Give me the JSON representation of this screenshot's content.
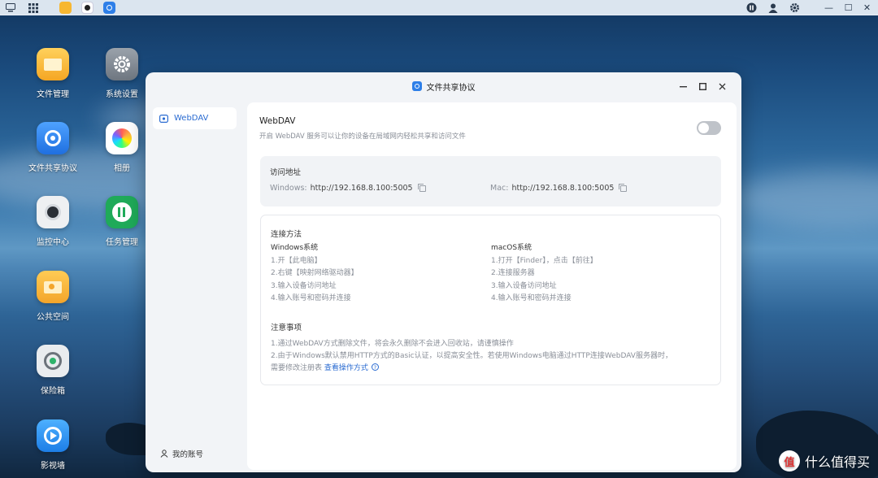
{
  "taskbar": {
    "right_icons": [
      "info-icon",
      "user-icon",
      "gear-icon"
    ],
    "window_controls": {
      "minimize": "—",
      "maximize": "☐",
      "close": "✕"
    }
  },
  "desktop_icons": [
    {
      "label": "文件管理",
      "icon": "folder-icon",
      "color": "#f7b731"
    },
    {
      "label": "系统设置",
      "icon": "gear-icon",
      "color": "#7d858f"
    },
    {
      "label": "文件共享协议",
      "icon": "share-icon",
      "color": "#2e7fe8"
    },
    {
      "label": "相册",
      "icon": "photos-icon",
      "color": "#ffffff"
    },
    {
      "label": "监控中心",
      "icon": "camera-icon",
      "color": "#e9ecef"
    },
    {
      "label": "任务管理",
      "icon": "tasks-icon",
      "color": "#1faa59"
    },
    {
      "label": "公共空间",
      "icon": "public-folder-icon",
      "color": "#f6b436"
    },
    {
      "label": "保险箱",
      "icon": "safe-icon",
      "color": "#e6e9ec"
    },
    {
      "label": "影视墙",
      "icon": "video-icon",
      "color": "#2e8ff0"
    }
  ],
  "window": {
    "title": "文件共享协议",
    "sidebar_item": "WebDAV",
    "account": "我的账号"
  },
  "webdav": {
    "title": "WebDAV",
    "description": "开启 WebDAV 服务可以让你的设备在局域网内轻松共享和访问文件",
    "enabled": false
  },
  "address": {
    "heading": "访问地址",
    "windows_label": "Windows:",
    "windows_url": "http://192.168.8.100:5005",
    "mac_label": "Mac:",
    "mac_url": "http://192.168.8.100:5005"
  },
  "connection": {
    "heading": "连接方法",
    "windows": {
      "title": "Windows系统",
      "steps": [
        "1.开【此电脑】",
        "2.右键【映射网络驱动器】",
        "3.输入设备访问地址",
        "4.输入账号和密码并连接"
      ]
    },
    "mac": {
      "title": "macOS系统",
      "steps": [
        "1.打开【Finder】，点击【前往】",
        "2.连接服务器",
        "3.输入设备访问地址",
        "4.输入账号和密码并连接"
      ]
    }
  },
  "notes": {
    "heading": "注意事项",
    "line1": "1.通过WebDAV方式删除文件，将会永久删除不会进入回收站，请谨慎操作",
    "line2": "2.由于Windows默认禁用HTTP方式的Basic认证，以提高安全性。若使用Windows电脑通过HTTP连接WebDAV服务器时，",
    "line3": "需要修改注册表",
    "link": "查看操作方式"
  },
  "watermark": {
    "text": "什么值得买",
    "badge": "值"
  }
}
